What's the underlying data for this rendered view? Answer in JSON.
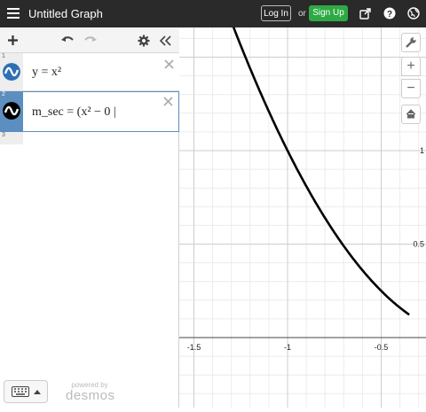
{
  "header": {
    "menu_icon": "hamburger-icon",
    "title": "Untitled Graph",
    "login_label": "Log In",
    "or_text": "or",
    "signup_label": "Sign Up",
    "icons": [
      "share-icon",
      "help-icon",
      "globe-icon"
    ],
    "signup_color": "#2eaa45",
    "bar_color": "#2a2a2a"
  },
  "sidebar": {
    "toolbar_icons": [
      "add-icon",
      "undo-icon",
      "redo-icon",
      "settings-icon",
      "collapse-icon"
    ],
    "expressions": [
      {
        "number": "1",
        "latex_text": "y = x²",
        "color": "#2d70b3",
        "active": false
      },
      {
        "number": "2",
        "latex_text": "m_sec = (x² − 0 |",
        "color": "#000000",
        "active": true
      },
      {
        "number": "3"
      }
    ],
    "keyboard_icon": "keyboard-icon",
    "powered_by": "powered by",
    "brand": "desmos"
  },
  "graph": {
    "x_ticks": [
      "-1.5",
      "-1",
      "-0.5"
    ],
    "y_ticks": [
      "1",
      "0.5"
    ],
    "curve_function": "y = x^2",
    "curve_color": "#000000",
    "controls": [
      "wrench-icon",
      "zoom-in-icon",
      "zoom-out-icon",
      "home-icon"
    ]
  }
}
